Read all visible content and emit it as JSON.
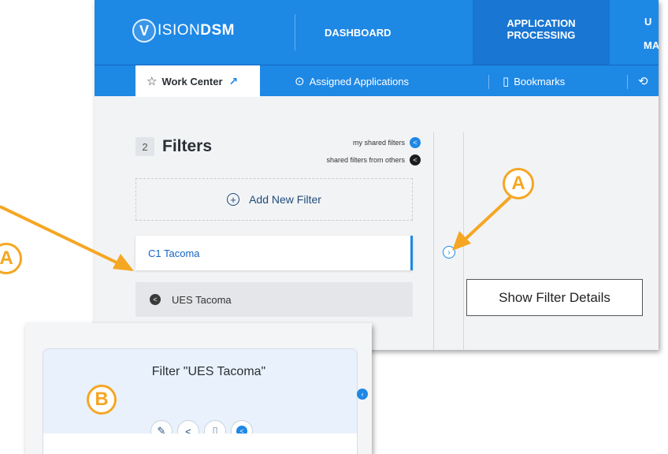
{
  "header": {
    "logo_text": "ISION",
    "logo_bold": "DSM",
    "logo_mark": "V",
    "nav": [
      {
        "label": "DASHBOARD"
      },
      {
        "label": "APPLICATION PROCESSING"
      },
      {
        "label": "U"
      },
      {
        "label": "MA"
      }
    ]
  },
  "subnav": {
    "work_center": "Work Center",
    "assigned": "Assigned Applications",
    "bookmarks": "Bookmarks"
  },
  "filters": {
    "count": "2",
    "title": "Filters",
    "legend_mine": "my shared filters",
    "legend_others": "shared filters from others",
    "add_label": "Add New Filter",
    "items": [
      {
        "label": "C1 Tacoma"
      },
      {
        "label": "UES Tacoma"
      }
    ]
  },
  "tooltip": {
    "text": "Show Filter Details"
  },
  "detail": {
    "title": "Filter \"UES Tacoma\""
  },
  "callouts": {
    "a": "A",
    "b": "B"
  },
  "colors": {
    "brand": "#1e88e5",
    "callout": "#f5a623"
  }
}
